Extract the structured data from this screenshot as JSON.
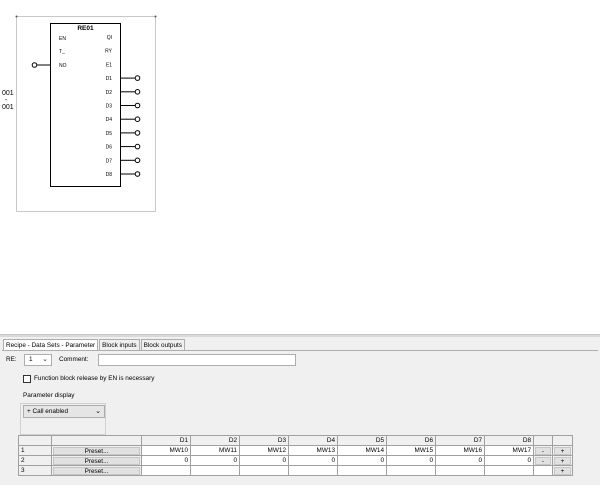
{
  "block": {
    "name": "RE01",
    "left_pins": [
      "EN",
      "T_",
      "NO"
    ],
    "right_pins": [
      "QI",
      "RY",
      "E1",
      "D1",
      "D2",
      "D3",
      "D4",
      "D5",
      "D6",
      "D7",
      "D8"
    ]
  },
  "rung": {
    "label_top": "001",
    "label_sep": "-",
    "label_bottom": "001"
  },
  "tabs": [
    "Recipe - Data Sets - Parameter",
    "Block inputs",
    "Block outputs"
  ],
  "form": {
    "re_label": "RE:",
    "re_value": "1",
    "comment_label": "Comment:",
    "comment_value": "",
    "release_label": "Function block release by EN is necessary",
    "param_display_label": "Parameter display",
    "param_display_value": "+ Call enabled"
  },
  "grid": {
    "headers": [
      "D1",
      "D2",
      "D3",
      "D4",
      "D5",
      "D6",
      "D7",
      "D8"
    ],
    "preset_label": "Preset...",
    "minus_label": "-",
    "plus_label": "+",
    "rows": [
      {
        "num": "1",
        "values": [
          "MW10",
          "MW11",
          "MW12",
          "MW13",
          "MW14",
          "MW15",
          "MW16",
          "MW17"
        ]
      },
      {
        "num": "2",
        "values": [
          "0",
          "0",
          "0",
          "0",
          "0",
          "0",
          "0",
          "0"
        ]
      },
      {
        "num": "3",
        "values": [
          "",
          "",
          "",
          "",
          "",
          "",
          "",
          ""
        ]
      }
    ]
  }
}
